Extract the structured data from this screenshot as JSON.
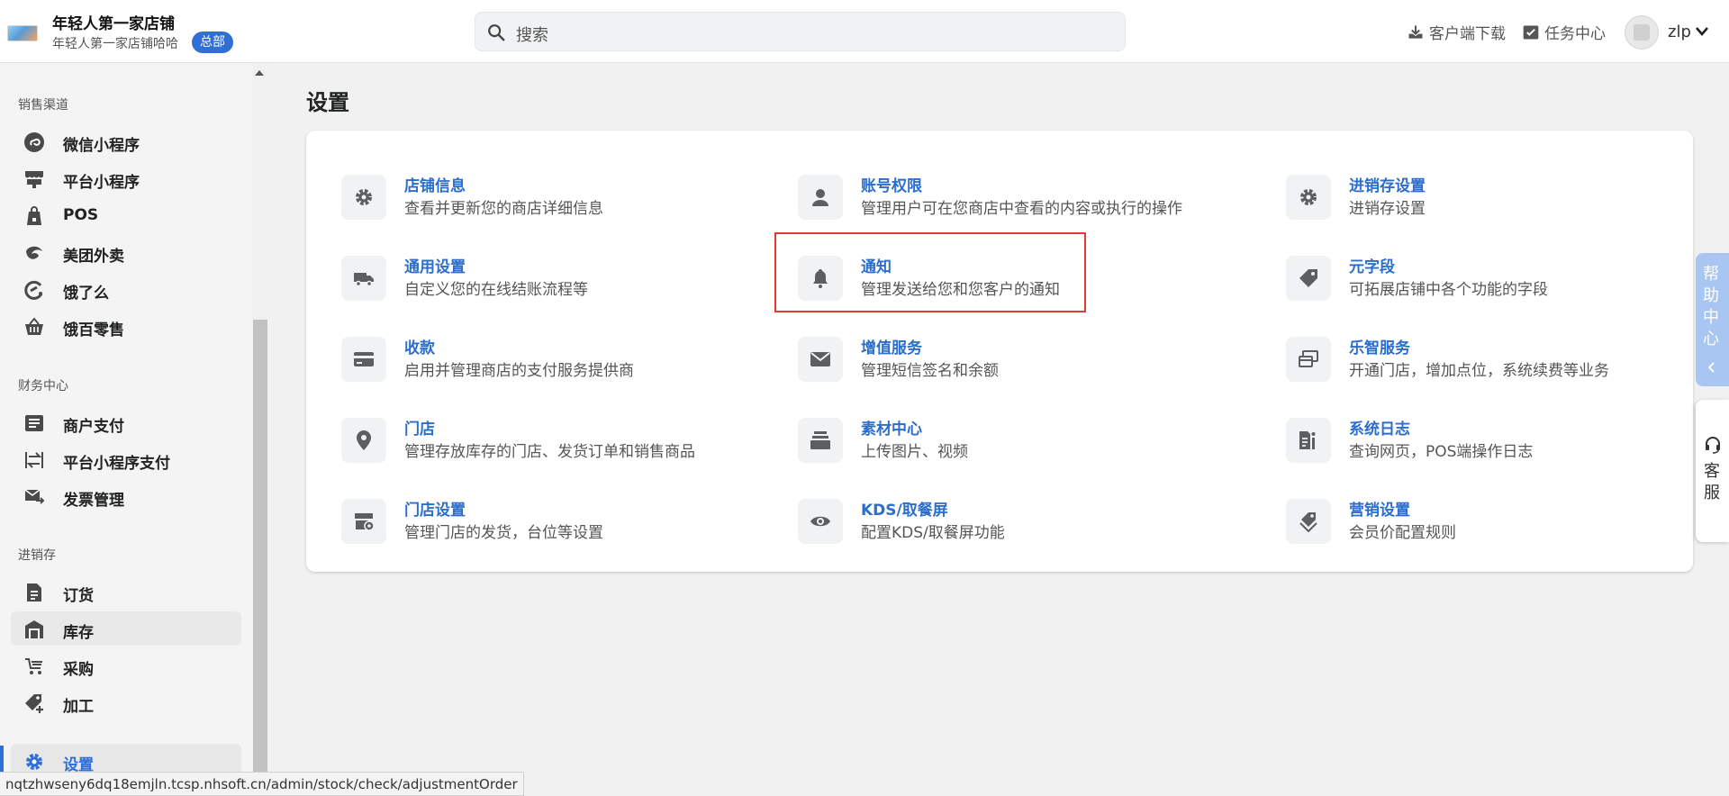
{
  "header": {
    "store_name": "年轻人第一家店铺",
    "store_sub": "年轻人第一家店铺哈哈",
    "hq_badge": "总部",
    "search_placeholder": "搜索",
    "download_label": "客户端下载",
    "task_label": "任务中心",
    "user_name": "zlp"
  },
  "sidebar": {
    "sections": [
      {
        "title": "销售渠道"
      },
      {
        "title": "财务中心"
      },
      {
        "title": "进销存"
      }
    ],
    "sales": [
      {
        "label": "微信小程序",
        "icon": "wechat-miniprogram-icon"
      },
      {
        "label": "平台小程序",
        "icon": "store-front-icon"
      },
      {
        "label": "POS",
        "icon": "shopping-bag-icon"
      },
      {
        "label": "美团外卖",
        "icon": "meituan-icon"
      },
      {
        "label": "饿了么",
        "icon": "eleme-icon"
      },
      {
        "label": "饿百零售",
        "icon": "basket-icon"
      }
    ],
    "finance": [
      {
        "label": "商户支付",
        "icon": "document-icon"
      },
      {
        "label": "平台小程序支付",
        "icon": "transfer-icon"
      },
      {
        "label": "发票管理",
        "icon": "invoice-mail-icon"
      }
    ],
    "inventory": [
      {
        "label": "订货",
        "icon": "order-doc-icon"
      },
      {
        "label": "库存",
        "icon": "warehouse-icon"
      },
      {
        "label": "采购",
        "icon": "purchase-icon"
      },
      {
        "label": "加工",
        "icon": "tag-plus-icon"
      }
    ],
    "settings": {
      "label": "设置",
      "icon": "gear-icon"
    }
  },
  "main": {
    "page_title": "设置",
    "items": [
      {
        "title": "店铺信息",
        "desc": "查看并更新您的商店详细信息",
        "icon": "gear-icon"
      },
      {
        "title": "账号权限",
        "desc": "管理用户可在您商店中查看的内容或执行的操作",
        "icon": "person-icon"
      },
      {
        "title": "进销存设置",
        "desc": "进销存设置",
        "icon": "gear-icon"
      },
      {
        "title": "通用设置",
        "desc": "自定义您的在线结账流程等",
        "icon": "truck-icon"
      },
      {
        "title": "通知",
        "desc": "管理发送给您和您客户的通知",
        "icon": "bell-icon"
      },
      {
        "title": "元字段",
        "desc": "可拓展店铺中各个功能的字段",
        "icon": "tag-icon"
      },
      {
        "title": "收款",
        "desc": "启用并管理商店的支付服务提供商",
        "icon": "credit-card-icon"
      },
      {
        "title": "增值服务",
        "desc": "管理短信签名和余额",
        "icon": "mail-icon"
      },
      {
        "title": "乐智服务",
        "desc": "开通门店，增加点位，系统续费等业务",
        "icon": "cards-icon"
      },
      {
        "title": "门店",
        "desc": "管理存放库存的门店、发货订单和销售商品",
        "icon": "location-pin-icon"
      },
      {
        "title": "素材中心",
        "desc": "上传图片、视频",
        "icon": "archive-icon"
      },
      {
        "title": "系统日志",
        "desc": "查询网页，POS端操作日志",
        "icon": "log-icon"
      },
      {
        "title": "门店设置",
        "desc": "管理门店的发货，台位等设置",
        "icon": "store-settings-icon"
      },
      {
        "title": "KDS/取餐屏",
        "desc": "配置KDS/取餐屏功能",
        "icon": "eye-icon"
      },
      {
        "title": "营销设置",
        "desc": "会员价配置规则",
        "icon": "tags-icon"
      }
    ]
  },
  "floating": {
    "help_label": "帮助中心",
    "service_label": "客服"
  },
  "status_url": "nqtzhwseny6dq18emjln.tcsp.nhsoft.cn/admin/stock/check/adjustmentOrder",
  "colors": {
    "accent": "#2f6fd6",
    "link": "#2c6ecb",
    "highlight": "#e53935"
  }
}
